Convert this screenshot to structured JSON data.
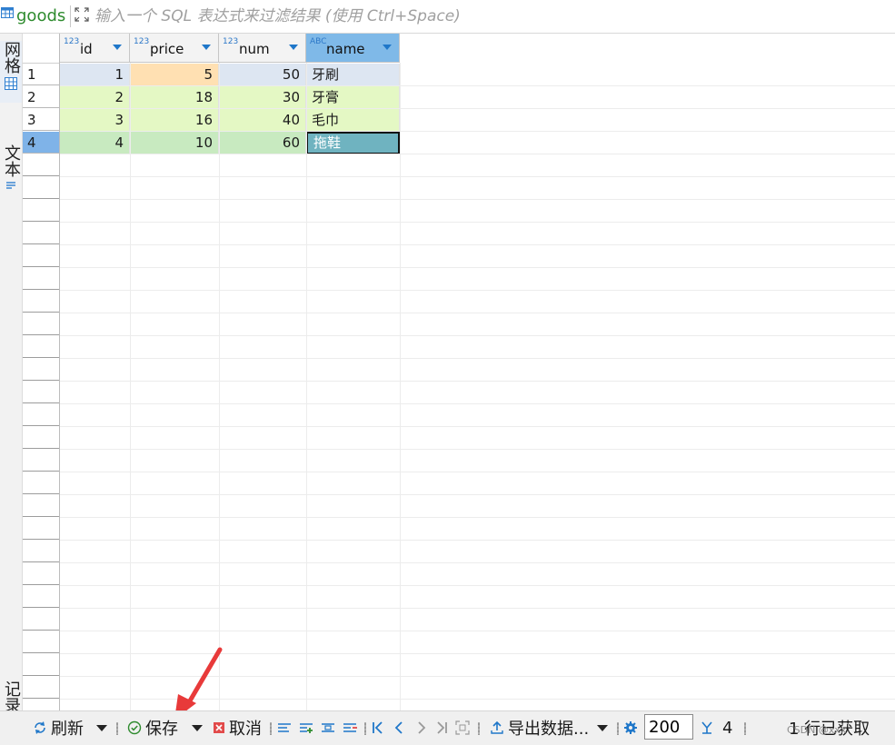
{
  "filter_bar": {
    "table_name": "goods",
    "placeholder": "输入一个 SQL 表达式来过滤结果 (使用 Ctrl+Space)"
  },
  "side_tabs": {
    "grid": "网格",
    "text": "文本",
    "record": "记录"
  },
  "columns": [
    {
      "type": "123",
      "name": "id"
    },
    {
      "type": "123",
      "name": "price"
    },
    {
      "type": "123",
      "name": "num"
    },
    {
      "type": "ABC",
      "name": "name"
    }
  ],
  "rows": [
    {
      "row_num": "1",
      "id": "1",
      "price": "5",
      "num": "50",
      "name": "牙刷"
    },
    {
      "row_num": "2",
      "id": "2",
      "price": "18",
      "num": "30",
      "name": "牙膏"
    },
    {
      "row_num": "3",
      "id": "3",
      "price": "16",
      "num": "40",
      "name": "毛巾"
    },
    {
      "row_num": "4",
      "id": "4",
      "price": "10",
      "num": "60",
      "name": "拖鞋"
    }
  ],
  "toolbar": {
    "refresh_label": "刷新",
    "save_label": "保存",
    "cancel_label": "取消",
    "export_label": "导出数据...",
    "fetch_size": "200",
    "fetch_count": "4",
    "status": "1 行已获取",
    "watermark": "CSDN @xxx"
  },
  "colors": {
    "selected_row_header": "#7fb3e8",
    "active_column_header": "#7fb9e8",
    "row1_bg": "#dde6f2",
    "row1_modified_cell": "#ffe0b2",
    "new_rows_bg": "#e4f8c4",
    "current_row_bg": "#c8eac0",
    "selected_cell_bg": "#6fb3c0",
    "table_name_green": "#2e8b2e",
    "accent_blue": "#1f77c9"
  }
}
